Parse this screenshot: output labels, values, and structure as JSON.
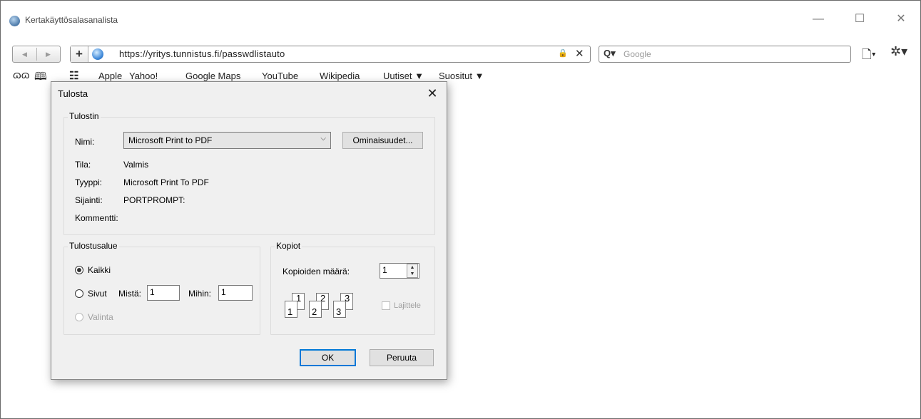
{
  "window": {
    "title": "Kertakäyttösalasanalista",
    "minimize": "—",
    "maximize": "☐",
    "close": "✕"
  },
  "nav": {
    "back": "◀",
    "forward": "▶"
  },
  "address": {
    "plus": "+",
    "url": "https://yritys.tunnistus.fi/passwdlistauto",
    "lock": "🔒",
    "clear": "✕"
  },
  "search": {
    "placeholder": "Google",
    "icon": "Q▾"
  },
  "toolbar": {
    "page_icon": "🗋▾",
    "gear_icon": "✲▾"
  },
  "bookmarks": {
    "reading_icon": "ɷɷ",
    "book_icon": "🕮",
    "grid_icon": "☷",
    "items": [
      "Apple",
      "Yahoo!",
      "Google Maps",
      "YouTube",
      "Wikipedia",
      "Uutiset ▼",
      "Suositut ▼"
    ]
  },
  "dialog": {
    "title": "Tulosta",
    "close": "✕",
    "printer": {
      "group": "Tulostin",
      "name_label": "Nimi:",
      "name_value": "Microsoft Print to PDF",
      "properties_button": "Ominaisuudet...",
      "status_label": "Tila:",
      "status_value": "Valmis",
      "type_label": "Tyyppi:",
      "type_value": "Microsoft Print To PDF",
      "location_label": "Sijainti:",
      "location_value": "PORTPROMPT:",
      "comment_label": "Kommentti:"
    },
    "range": {
      "group": "Tulostusalue",
      "all": "Kaikki",
      "pages": "Sivut",
      "from_label": "Mistä:",
      "from_value": "1",
      "to_label": "Mihin:",
      "to_value": "1",
      "selection": "Valinta"
    },
    "copies": {
      "group": "Kopiot",
      "count_label": "Kopioiden määrä:",
      "count_value": "1",
      "collate_label": "Lajittele",
      "pages": [
        "1",
        "2",
        "3"
      ]
    },
    "ok": "OK",
    "cancel": "Peruuta"
  }
}
